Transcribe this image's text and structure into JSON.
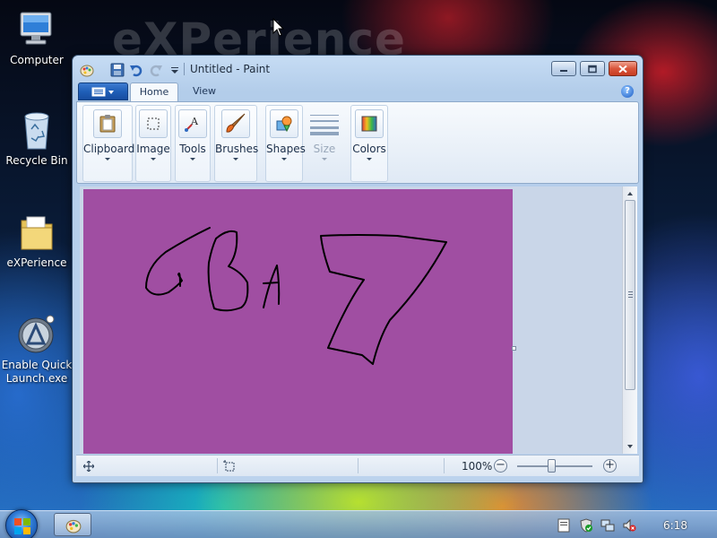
{
  "desktop": {
    "watermark": "eXPerience",
    "icons": [
      {
        "label": "Computer",
        "icon": "computer-icon"
      },
      {
        "label": "Recycle Bin",
        "icon": "recycle-bin-icon"
      },
      {
        "label": "eXPerience",
        "icon": "folder-icon"
      },
      {
        "label": "Enable Quick Launch.exe",
        "icon": "quick-launch-icon"
      }
    ]
  },
  "window": {
    "title": "Untitled - Paint",
    "tabs": [
      {
        "label": "Home",
        "active": true
      },
      {
        "label": "View",
        "active": false
      }
    ],
    "ribbon_groups": [
      {
        "label": "Clipboard",
        "icon": "clipboard-icon",
        "enabled": true
      },
      {
        "label": "Image",
        "icon": "select-icon",
        "enabled": true
      },
      {
        "label": "Tools",
        "icon": "text-tool-icon",
        "enabled": true
      },
      {
        "label": "Brushes",
        "icon": "brush-icon",
        "enabled": true
      },
      {
        "label": "Shapes",
        "icon": "shapes-icon",
        "enabled": true
      },
      {
        "label": "Size",
        "icon": "line-size-icon",
        "enabled": false
      },
      {
        "label": "Colors",
        "icon": "colors-icon",
        "enabled": true
      }
    ],
    "canvas": {
      "background_color": "#a04ea2",
      "stroke_color": "#000000",
      "drawing_text": "GBA 7"
    },
    "status": {
      "zoom": "100%",
      "zoom_out": "−",
      "zoom_in": "+"
    }
  },
  "taskbar": {
    "clock": "6:18"
  }
}
